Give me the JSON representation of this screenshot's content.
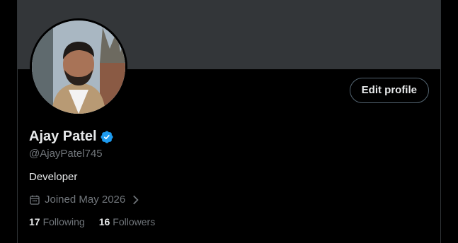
{
  "profile": {
    "display_name": "Ajay Patel",
    "handle": "@AjayPatel745",
    "bio": "Developer",
    "joined": "Joined May 2026",
    "following_count": "17",
    "following_label": "Following",
    "followers_count": "16",
    "followers_label": "Followers"
  },
  "actions": {
    "edit_profile": "Edit profile"
  },
  "icons": {
    "verified": "verified-badge-icon",
    "calendar": "calendar-icon",
    "chevron": "chevron-right-icon"
  },
  "colors": {
    "background": "#000000",
    "banner": "#333639",
    "verified": "#1d9bf0",
    "muted_text": "#71767b",
    "primary_text": "#e7e9ea"
  }
}
